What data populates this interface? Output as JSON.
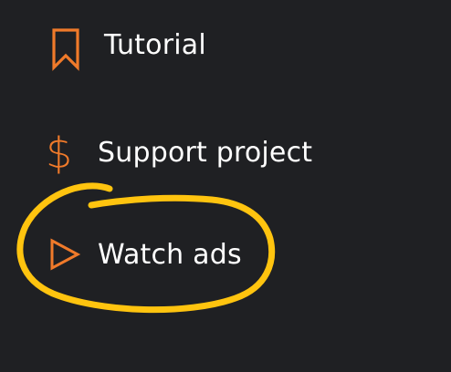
{
  "colors": {
    "background": "#1f2023",
    "icon_accent": "#f07a2a",
    "highlight": "#ffc40f",
    "text": "#ffffff"
  },
  "menu": {
    "items": [
      {
        "label": "Tutorial",
        "icon": "bookmark-icon"
      },
      {
        "label": "Support project",
        "icon": "dollar-icon",
        "glyph": "$"
      },
      {
        "label": "Watch ads",
        "icon": "play-icon"
      }
    ]
  }
}
